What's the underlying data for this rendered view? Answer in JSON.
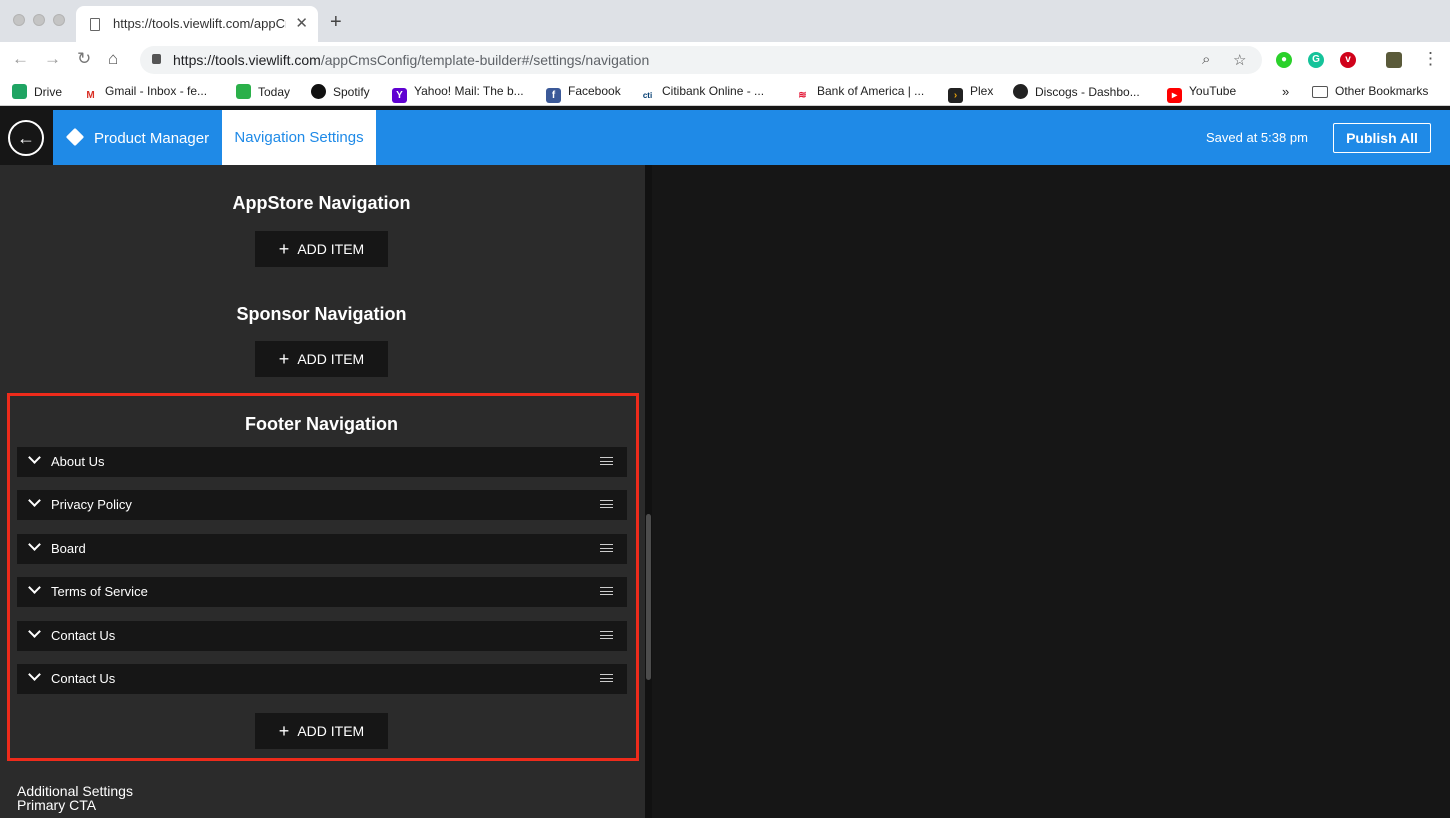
{
  "browser": {
    "tab_title": "https://tools.viewlift.com/appCmsConfig/template-builder#/settings/navigation",
    "new_tab": "+",
    "close_tab": "✕",
    "url_host": "https://tools.viewlift.com",
    "url_path": "/appCmsConfig/template-builder#/settings/navigation",
    "bookmarks": [
      {
        "label": "Drive",
        "icon": "drive-icon",
        "color": "#1fa463"
      },
      {
        "label": "Gmail - Inbox - fe...",
        "icon": "gmail-icon",
        "color": "#d93025"
      },
      {
        "label": "Today",
        "icon": "today-icon",
        "color": "#2bb04a"
      },
      {
        "label": "Spotify",
        "icon": "spotify-icon",
        "color": "#111111"
      },
      {
        "label": "Yahoo! Mail: The b...",
        "icon": "yahoo-icon",
        "color": "#5f01d1"
      },
      {
        "label": "Facebook",
        "icon": "facebook-icon",
        "color": "#3b5998"
      },
      {
        "label": "Citibank Online - ...",
        "icon": "citi-icon",
        "color": "#003b70"
      },
      {
        "label": "Bank of America | ...",
        "icon": "boa-icon",
        "color": "#e31837"
      },
      {
        "label": "Plex",
        "icon": "plex-icon",
        "color": "#e5a00d"
      },
      {
        "label": "Discogs - Dashbo...",
        "icon": "discogs-icon",
        "color": "#222222"
      },
      {
        "label": "YouTube",
        "icon": "youtube-icon",
        "color": "#ff0000"
      }
    ],
    "more_bookmarks": "»",
    "other_bookmarks": "Other Bookmarks"
  },
  "app": {
    "product_manager": "Product Manager",
    "active_tab": "Navigation Settings",
    "saved_status": "Saved at 5:38 pm",
    "publish_label": "Publish All",
    "accent_color": "#1f8ae7"
  },
  "panel": {
    "appstore_title": "AppStore Navigation",
    "sponsor_title": "Sponsor Navigation",
    "footer_title": "Footer Navigation",
    "add_item_label": "ADD ITEM",
    "footer_items": [
      "About Us",
      "Privacy Policy",
      "Board",
      "Terms of Service",
      "Contact Us",
      "Contact Us"
    ],
    "additional_settings": "Additional Settings",
    "primary_cta": "Primary CTA",
    "highlight_color": "#ee2b1b"
  }
}
